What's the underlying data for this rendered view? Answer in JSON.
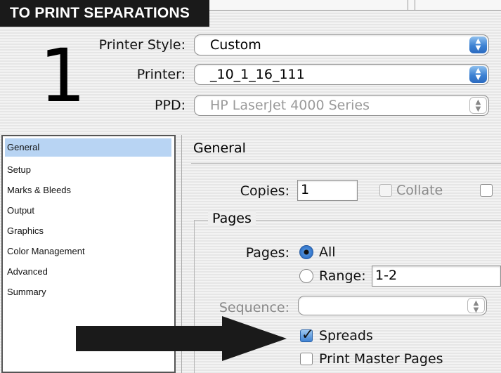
{
  "banner": {
    "title": "TO PRINT SEPARATIONS"
  },
  "step": {
    "number": "1"
  },
  "printer_style": {
    "label": "Printer Style:",
    "value": "Custom"
  },
  "printer": {
    "label": "Printer:",
    "value": "_10_1_16_111"
  },
  "ppd": {
    "label": "PPD:",
    "value": "HP LaserJet 4000 Series"
  },
  "sidebar": {
    "items": [
      {
        "label": "General",
        "selected": true
      },
      {
        "label": "Setup"
      },
      {
        "label": "Marks & Bleeds"
      },
      {
        "label": "Output"
      },
      {
        "label": "Graphics"
      },
      {
        "label": "Color Management"
      },
      {
        "label": "Advanced"
      },
      {
        "label": "Summary"
      }
    ]
  },
  "section": {
    "title": "General"
  },
  "copies": {
    "label": "Copies:",
    "value": "1"
  },
  "collate": {
    "label": "Collate",
    "checked": false,
    "enabled": false
  },
  "pages_group": {
    "title": "Pages",
    "pages_label": "Pages:",
    "all_label": "All",
    "range_label": "Range:",
    "range_value": "1-2",
    "sequence_label": "Sequence:",
    "spreads_label": "Spreads",
    "spreads_checked": true,
    "master_pages_label": "Print Master Pages",
    "master_pages_checked": false
  },
  "colors": {
    "accent": "#3d82d3",
    "banner": "#1a1a1a",
    "selection": "#b8d4f3"
  }
}
